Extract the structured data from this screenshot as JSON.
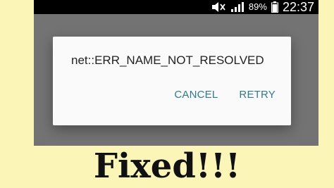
{
  "status_bar": {
    "battery_percent": "89%",
    "time": "22:37",
    "icons": [
      "mute-icon",
      "signal-icon",
      "battery-icon"
    ]
  },
  "dialog": {
    "message": "net::ERR_NAME_NOT_RESOLVED",
    "cancel_label": "CANCEL",
    "retry_label": "RETRY",
    "button_color": "#2f7a8e"
  },
  "caption": {
    "text": "Fixed!!!"
  },
  "colors": {
    "background": "#fbf6b8",
    "scrim": "#737373",
    "status_bar": "#000000",
    "dialog": "#fafafa"
  }
}
